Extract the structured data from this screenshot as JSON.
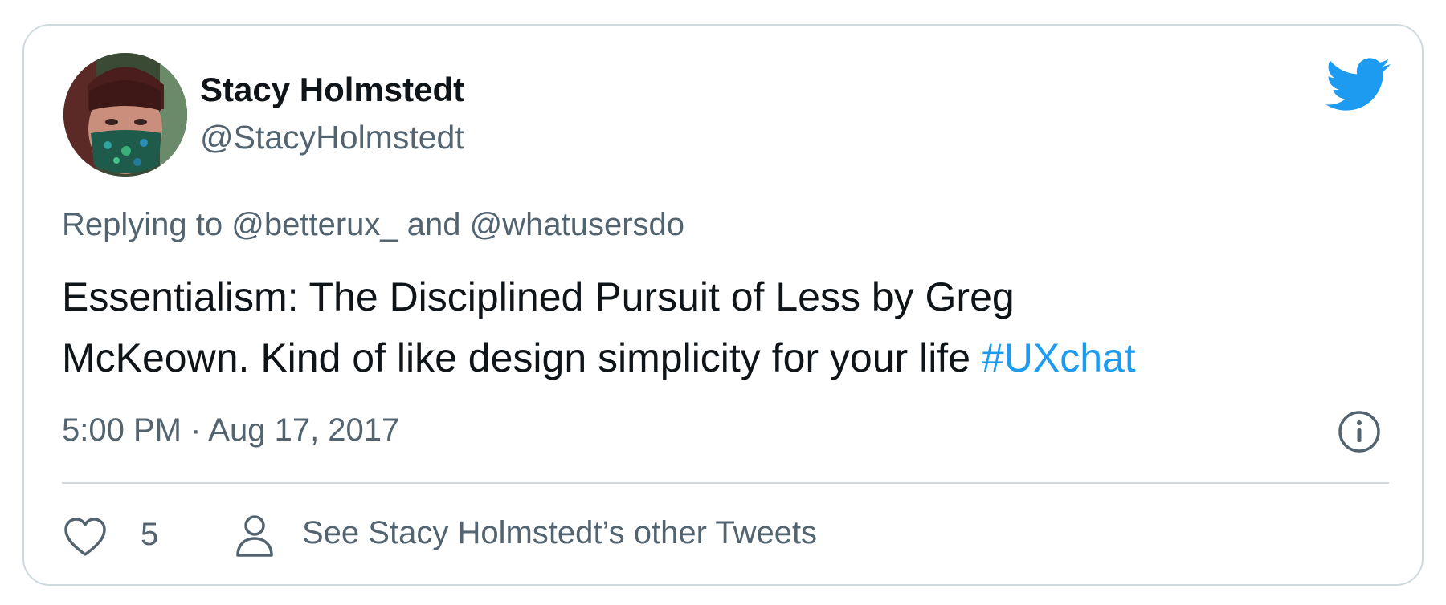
{
  "tweet": {
    "display_name": "Stacy Holmstedt",
    "handle": "@StacyHolmstedt",
    "replying_prefix": "Replying to",
    "reply_to_1": "@betterux_",
    "reply_and": "and",
    "reply_to_2": "@whatusersdo",
    "text_line_1": "Essentialism: The Disciplined Pursuit of Less by Greg",
    "text_line_2": "McKeown. Kind of like design simplicity for your life",
    "hashtag": "#UXchat",
    "timestamp": "5:00 PM · Aug 17, 2017",
    "like_count": "5",
    "other_tweets_link": "See Stacy Holmstedt’s other Tweets"
  },
  "icons": {
    "brand": "twitter-bird-icon",
    "info": "info-icon",
    "like": "heart-icon",
    "profile": "user-icon"
  },
  "colors": {
    "brand_blue": "#1d9bf0",
    "text_primary": "#0f1419",
    "text_secondary": "#536471",
    "border": "#cfd9de"
  }
}
